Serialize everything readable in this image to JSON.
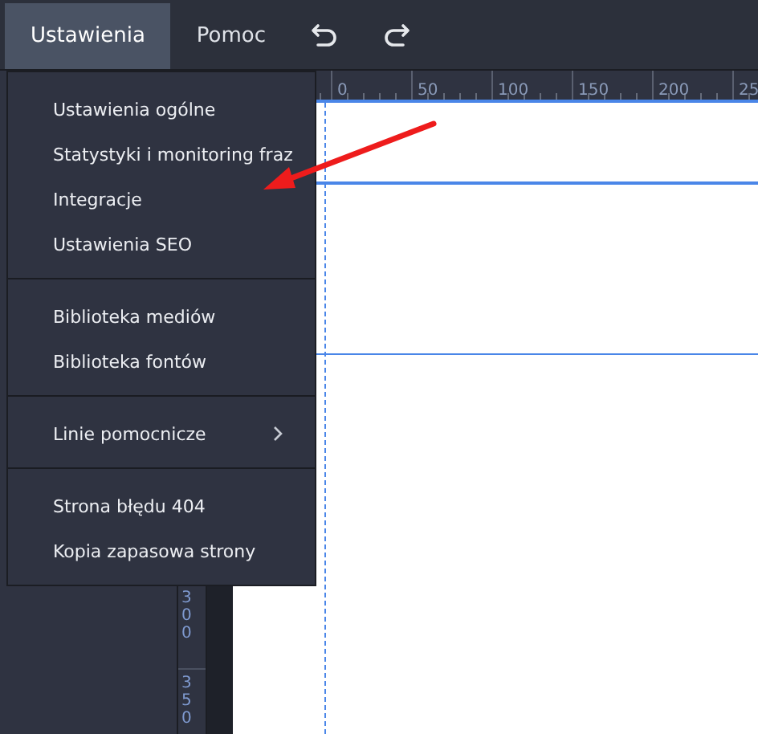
{
  "menubar": [
    {
      "label": "Ustawienia",
      "selected": true
    },
    {
      "label": "Pomoc",
      "selected": false
    }
  ],
  "dropdown": {
    "groups": [
      {
        "items": [
          {
            "label": "Ustawienia ogólne",
            "has_submenu": false
          },
          {
            "label": "Statystyki i monitoring fraz",
            "has_submenu": false
          },
          {
            "label": "Integracje",
            "has_submenu": false
          },
          {
            "label": "Ustawienia SEO",
            "has_submenu": false
          }
        ]
      },
      {
        "items": [
          {
            "label": "Biblioteka mediów",
            "has_submenu": false
          },
          {
            "label": "Biblioteka fontów",
            "has_submenu": false
          }
        ]
      },
      {
        "items": [
          {
            "label": "Linie pomocnicze",
            "has_submenu": true
          }
        ]
      },
      {
        "items": [
          {
            "label": "Strona błędu 404",
            "has_submenu": false
          },
          {
            "label": "Kopia zapasowa strony",
            "has_submenu": false
          }
        ]
      }
    ]
  },
  "top_ruler": {
    "labels": [
      "0",
      "50",
      "100",
      "150",
      "200",
      "25"
    ]
  },
  "side_ruler": {
    "labels": [
      "300",
      "350"
    ]
  }
}
